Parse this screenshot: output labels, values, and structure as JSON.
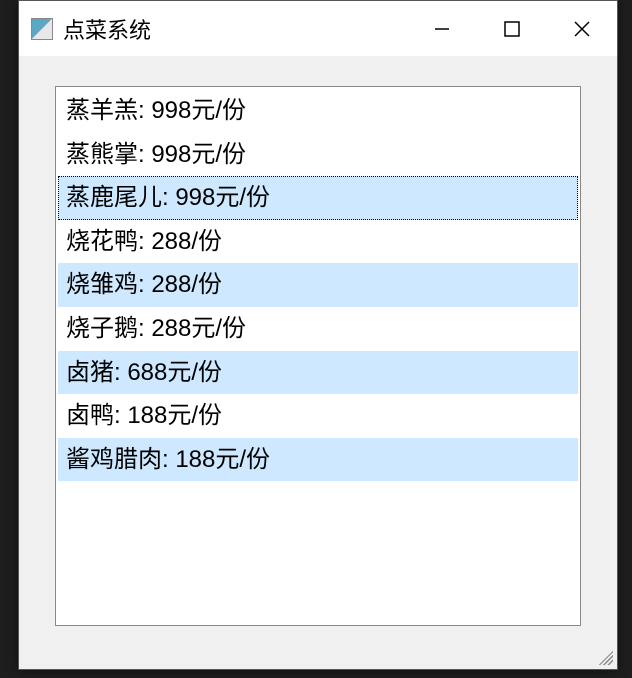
{
  "window": {
    "title": "点菜系统"
  },
  "menu": {
    "items": [
      {
        "label": "蒸羊羔: 998元/份",
        "selected": false,
        "focused": false
      },
      {
        "label": "蒸熊掌: 998元/份",
        "selected": false,
        "focused": false
      },
      {
        "label": "蒸鹿尾儿: 998元/份",
        "selected": true,
        "focused": true
      },
      {
        "label": "烧花鸭: 288/份",
        "selected": false,
        "focused": false
      },
      {
        "label": "烧雏鸡: 288/份",
        "selected": true,
        "focused": false
      },
      {
        "label": "烧子鹅: 288元/份",
        "selected": false,
        "focused": false
      },
      {
        "label": "卤猪: 688元/份",
        "selected": true,
        "focused": false
      },
      {
        "label": "卤鸭: 188元/份",
        "selected": false,
        "focused": false
      },
      {
        "label": "酱鸡腊肉: 188元/份",
        "selected": true,
        "focused": false
      }
    ]
  }
}
